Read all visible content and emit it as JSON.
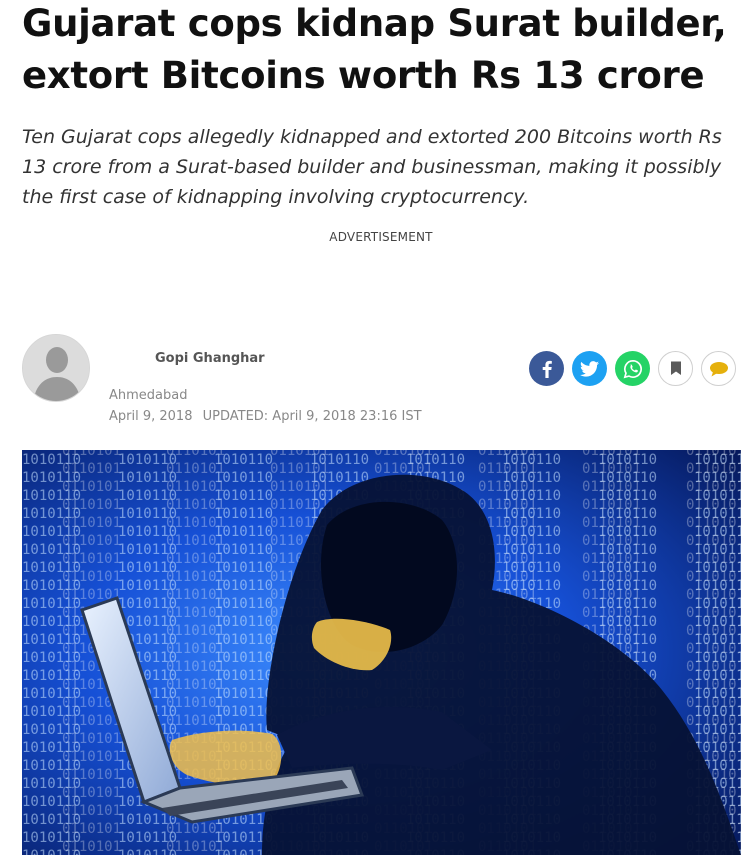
{
  "article": {
    "headline": "Gujarat cops kidnap Surat builder, extort Bitcoins worth Rs 13 crore",
    "summary": "Ten Gujarat cops allegedly kidnapped and extorted 200 Bitcoins worth Rs 13 crore from a Surat-based builder and businessman, making it possibly the first case of kidnapping involving cryptocurrency.",
    "advertisement_label": "ADVERTISEMENT"
  },
  "byline": {
    "author": "Gopi Ghanghar",
    "location": "Ahmedabad",
    "published": "April 9, 2018",
    "updated": "UPDATED: April 9, 2018 23:16 IST"
  },
  "share": {
    "facebook_icon": "facebook-icon",
    "twitter_icon": "twitter-icon",
    "whatsapp_icon": "whatsapp-icon",
    "bookmark_icon": "bookmark-icon",
    "comment_icon": "comment-icon"
  },
  "colors": {
    "facebook": "#3b5998",
    "twitter": "#1da1f2",
    "whatsapp": "#25d366",
    "comment": "#e5b00c"
  }
}
